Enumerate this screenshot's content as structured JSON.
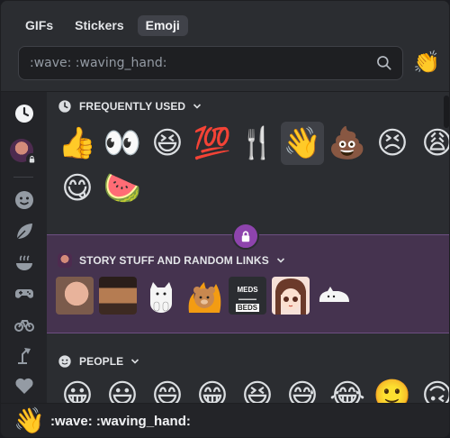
{
  "tabs": [
    {
      "label": "GIFs"
    },
    {
      "label": "Stickers"
    },
    {
      "label": "Emoji",
      "active": true
    }
  ],
  "search": {
    "value": ":wave: :waving_hand:"
  },
  "sidebar": {
    "items": [
      {
        "icon": "clock-icon"
      },
      {
        "icon": "server-avatar"
      },
      {
        "icon": "smiley-icon"
      },
      {
        "icon": "leaf-icon"
      },
      {
        "icon": "food-bowl-icon"
      },
      {
        "icon": "gamepad-icon"
      },
      {
        "icon": "bicycle-icon"
      },
      {
        "icon": "lamp-icon"
      },
      {
        "icon": "heart-icon"
      },
      {
        "icon": "flag-icon"
      }
    ]
  },
  "sections": {
    "frequent": {
      "title": "FREQUENTLY USED",
      "emojis": [
        "👍",
        "👀",
        "😆",
        "💯",
        "🍴",
        "👋",
        "💩",
        "😣",
        "😩",
        "😋",
        "🍉"
      ]
    },
    "server": {
      "title": "STORY STUFF AND RANDOM LINKS",
      "stickers": [
        "meme-face",
        "meme-scene",
        "cat-hands",
        "bear-fire",
        "meds-text",
        "anime-girl",
        "cat-lying"
      ],
      "meds_label": "MEDS",
      "meds_sub": "BEDS"
    },
    "people": {
      "title": "PEOPLE",
      "emojis": [
        "😀",
        "😃",
        "😄",
        "😁",
        "😆",
        "😅",
        "😂",
        "🙂",
        "🙃"
      ]
    }
  },
  "footer": {
    "emoji": "👋",
    "label": ":wave: :waving_hand:"
  },
  "colors": {
    "accent": "#8e44ad",
    "background": "#2b2d31",
    "band": "#45334f"
  }
}
